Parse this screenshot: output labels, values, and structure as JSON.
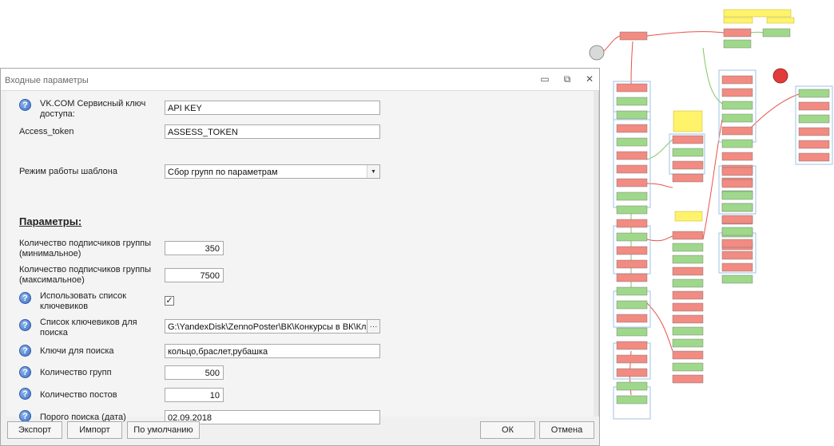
{
  "dialog": {
    "title": "Входные параметры",
    "window_buttons": {
      "minimize": "▭",
      "restore": "⧉",
      "close": "✕"
    }
  },
  "fields": {
    "vk_key": {
      "label": "VK.COM Сервисный ключ доступа:",
      "value": "API KEY"
    },
    "access_token": {
      "label": "Access_token",
      "value": "ASSESS_TOKEN"
    },
    "mode": {
      "label": "Режим работы шаблона",
      "value": "Сбор групп по параметрам"
    },
    "section_title": "Параметры:",
    "subs_min": {
      "label": "Количество подписчиков группы (минимальное)",
      "value": "350"
    },
    "subs_max": {
      "label": "Количество подписчиков группы (максимальное)",
      "value": "7500"
    },
    "use_keywords": {
      "label": "Использовать список ключевиков",
      "checked": true,
      "mark": "✓"
    },
    "keyword_list": {
      "label": "Список ключевиков для поиска",
      "value": "G:\\YandexDisk\\ZennoPoster\\ВК\\Конкурсы в ВК\\Ключи",
      "browse": "···"
    },
    "search_keys": {
      "label": "Ключи для поиска",
      "value": "кольцо,браслет,рубашка"
    },
    "group_count": {
      "label": "Количество групп",
      "value": "500"
    },
    "post_count": {
      "label": "Количество постов",
      "value": "10"
    },
    "search_date": {
      "label": "Порого поиска (дата)",
      "value": "02.09.2018"
    }
  },
  "buttons": {
    "export": "Экспорт",
    "import": "Импорт",
    "default": "По умолчанию",
    "ok": "ОК",
    "cancel": "Отмена"
  },
  "icons": {
    "help": "?",
    "dropdown": "▼"
  },
  "colors": {
    "node_red": "#f28b82",
    "node_green": "#9fd88a",
    "node_group_border": "#9ec3e6",
    "note_yellow": "#fff36b",
    "link_red": "#e8524a",
    "link_green": "#7fc45f"
  }
}
